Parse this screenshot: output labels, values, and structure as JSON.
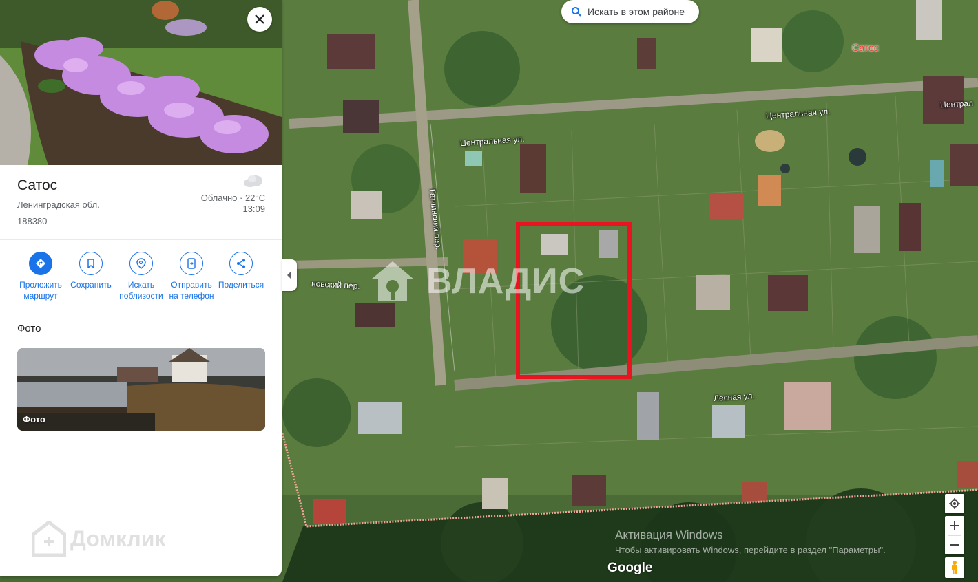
{
  "place": {
    "title": "Сатос",
    "region": "Ленинградская обл.",
    "postcode": "188380",
    "weather": "Облачно · 22°C",
    "time": "13:09"
  },
  "actions": [
    {
      "label1": "Проложить",
      "label2": "маршрут",
      "icon": "directions-icon"
    },
    {
      "label1": "Сохранить",
      "label2": "",
      "icon": "bookmark-icon"
    },
    {
      "label1": "Искать",
      "label2": "поблизости",
      "icon": "nearby-icon"
    },
    {
      "label1": "Отправить",
      "label2": "на телефон",
      "icon": "send-to-phone-icon"
    },
    {
      "label1": "Поделиться",
      "label2": "",
      "icon": "share-icon"
    }
  ],
  "photos": {
    "heading": "Фото",
    "caption": "Фото"
  },
  "map": {
    "search_button": "Искать в этом районе",
    "marker_label": "Сатос",
    "streets": {
      "central_1": "Центральная ул.",
      "central_2": "Центральная ул.",
      "central_3": "Централ",
      "gatchinsky": "Гатчинский пер.",
      "lane_partial": "новский пер.",
      "lesnaya": "Лесная ул."
    },
    "watermark": "ВЛАДИС",
    "google": "Google",
    "windows_activation": "Активация Windows",
    "windows_activation_sub": "Чтобы активировать Windows, перейдите в раздел \"Параметры\"."
  },
  "panel_watermark": "Домклик",
  "colors": {
    "accent": "#1a73e8",
    "highlight": "#e8141f",
    "boundary": "#f3a59a"
  }
}
